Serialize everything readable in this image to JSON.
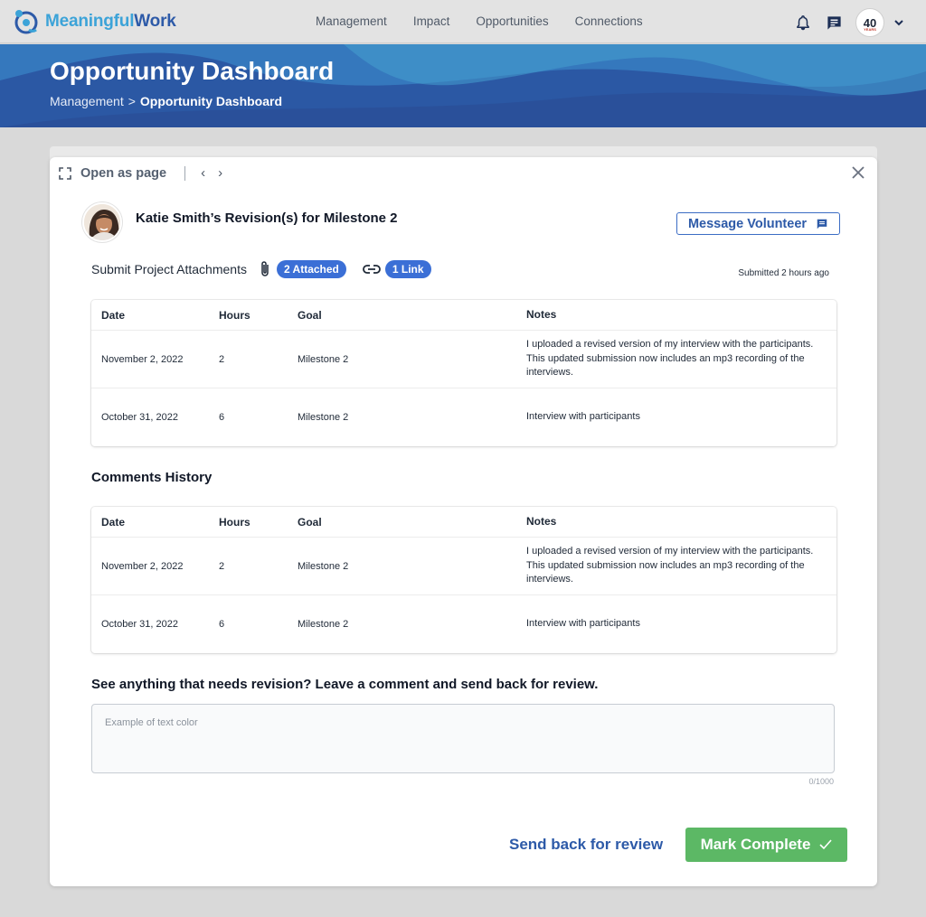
{
  "app": {
    "logo_part1": "Meaningful",
    "logo_part2": "Work"
  },
  "nav": {
    "links": [
      "Management",
      "Impact",
      "Opportunities",
      "Connections"
    ],
    "badge_text": "40",
    "badge_sub": "YEARS"
  },
  "banner": {
    "title": "Opportunity Dashboard",
    "breadcrumb_parent": "Management",
    "breadcrumb_sep": ">",
    "breadcrumb_current": "Opportunity Dashboard"
  },
  "modal": {
    "open_as_page": "Open as page",
    "person_name": "Katie Smith’s Revision(s) for Milestone 2",
    "message_button": "Message Volunteer",
    "attachments_label": "Submit Project Attachments",
    "attached_pill": "2 Attached",
    "link_pill": "1 Link",
    "submitted": "Submitted 2 hours ago"
  },
  "table1": {
    "headers": [
      "Date",
      "Hours",
      "Goal",
      "Notes"
    ],
    "rows": [
      [
        "November 2, 2022",
        "2",
        "Milestone 2",
        "I uploaded a revised version of my interview with the participants. This updated submission now includes an mp3 recording of the interviews."
      ],
      [
        "October 31, 2022",
        "6",
        "Milestone 2",
        "Interview with participants"
      ]
    ]
  },
  "comments": {
    "title": "Comments History",
    "headers": [
      "Date",
      "Hours",
      "Goal",
      "Notes"
    ],
    "rows": [
      [
        "November 2, 2022",
        "2",
        "Milestone 2",
        "I uploaded a revised version of my interview with the participants. This updated submission now includes an mp3 recording of the interviews."
      ],
      [
        "October 31, 2022",
        "6",
        "Milestone 2",
        "Interview with participants"
      ]
    ]
  },
  "review": {
    "prompt": "See anything that needs revision? Leave a comment and send back for review.",
    "placeholder": "Example of text color",
    "counter": "0/1000",
    "send_back": "Send back for review",
    "mark_complete": "Mark Complete"
  },
  "colors": {
    "primary": "#2d5aa8",
    "accent": "#3ca3d8",
    "pill": "#3b6fd6",
    "success": "#5cb865"
  }
}
